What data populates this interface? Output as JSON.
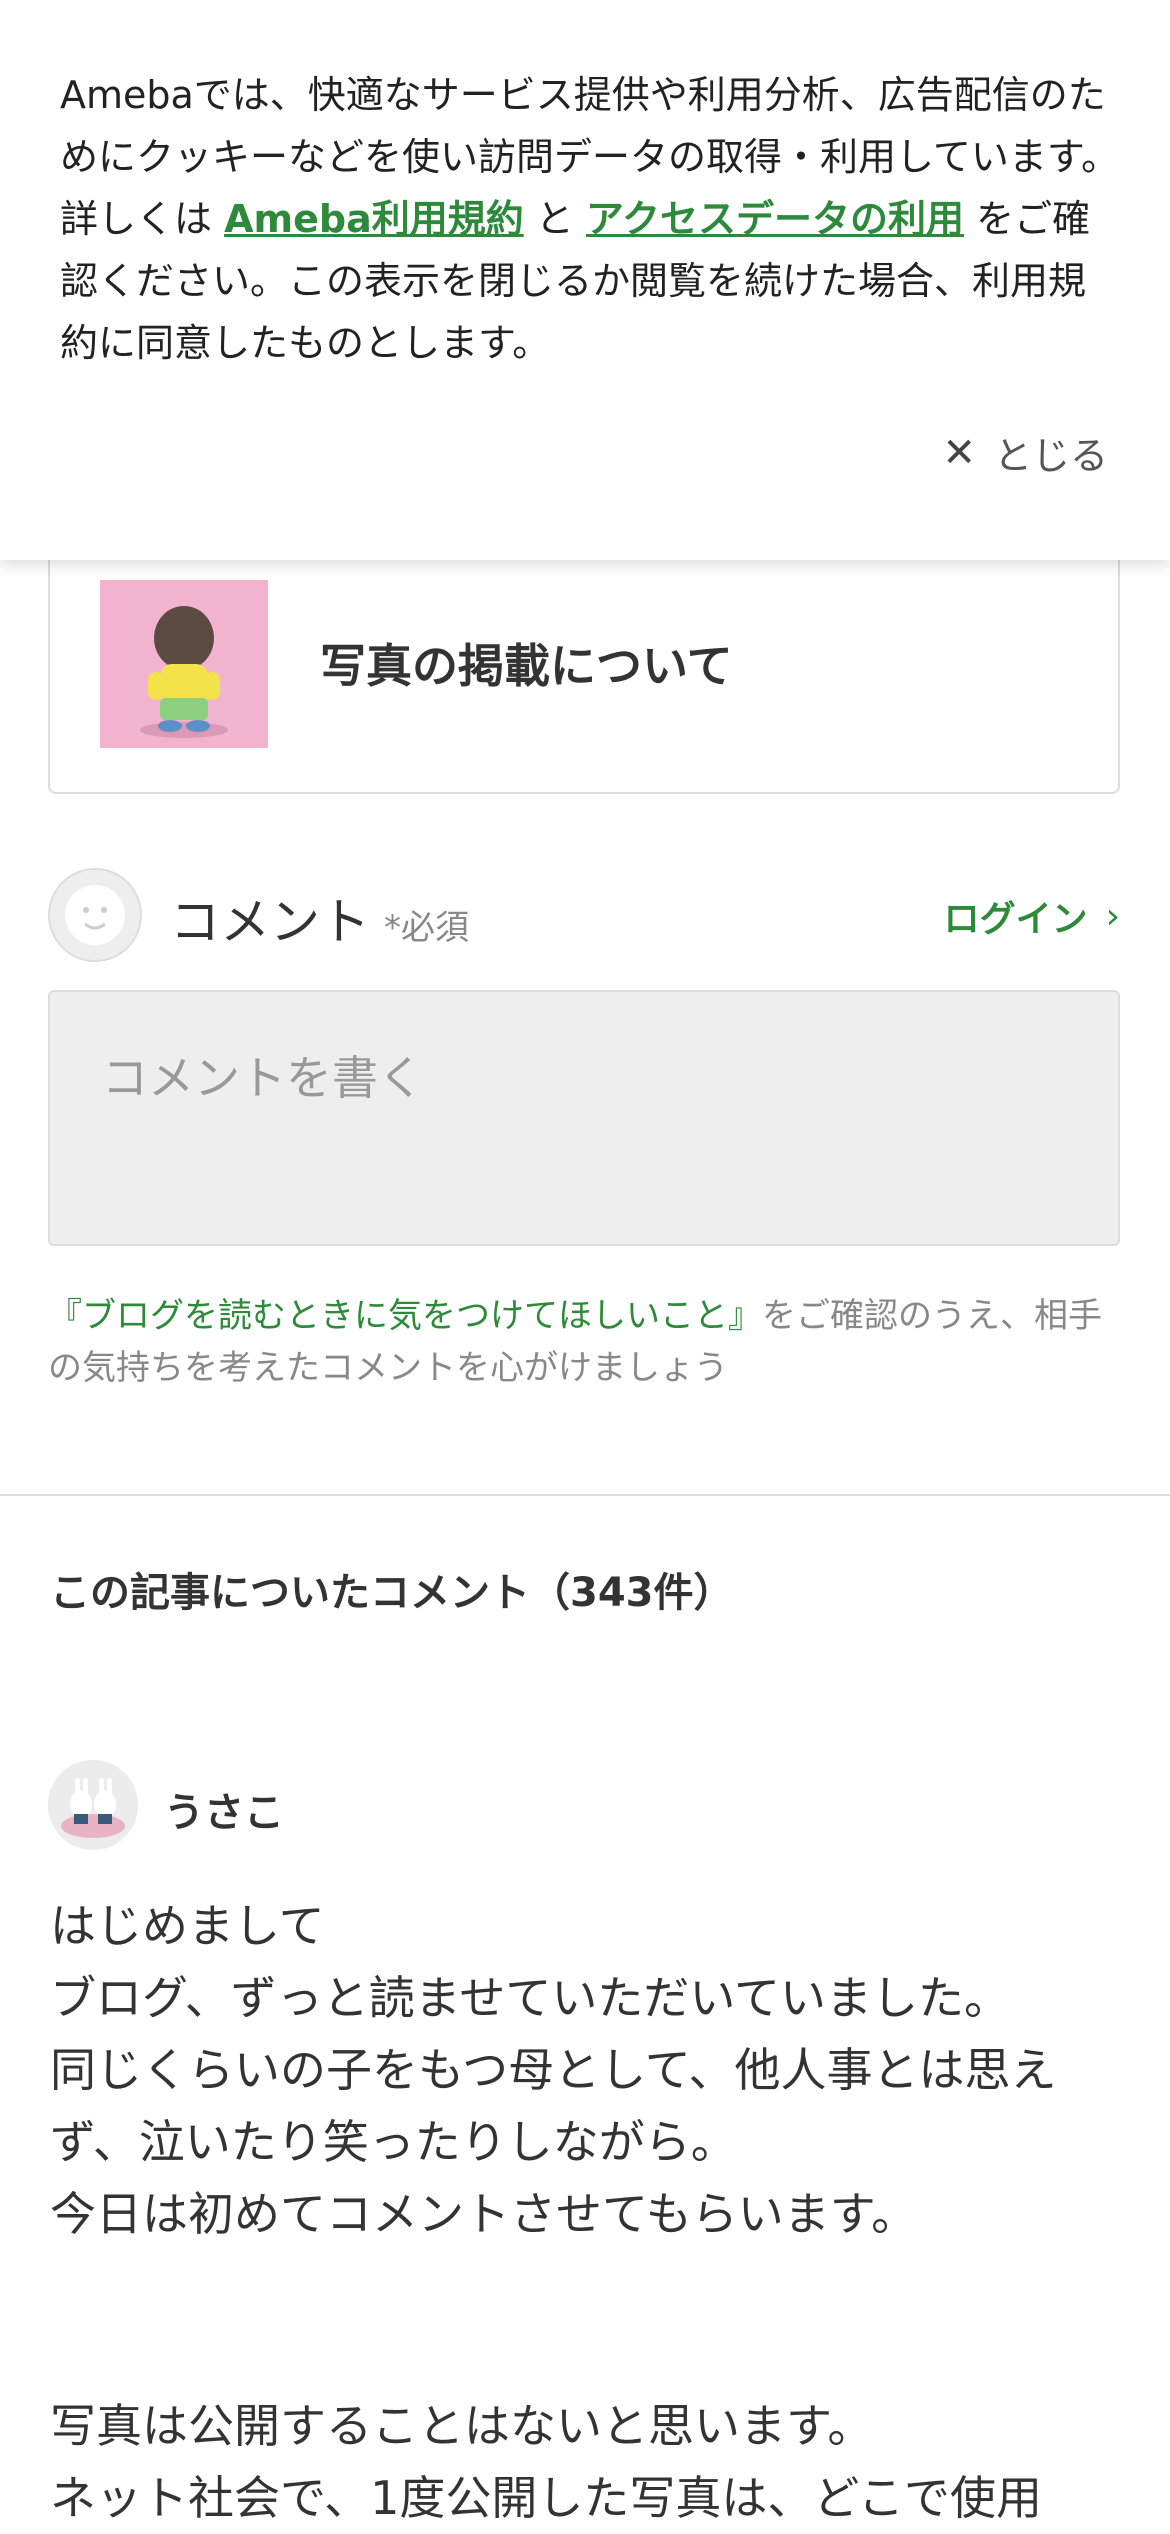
{
  "cookie_banner": {
    "text_before": "Amebaでは、快適なサービス提供や利用分析、広告配信のためにクッキーなどを使い訪問データの取得・利用しています。詳しくは ",
    "link1": "Ameba利用規約",
    "text_mid": " と ",
    "link2": "アクセスデータの利用",
    "text_after": " をご確認ください。この表示を閉じるか閲覧を続けた場合、利用規約に同意したものとします。",
    "close_label": "とじる",
    "close_icon": "close-icon"
  },
  "related_card": {
    "title": "写真の掲載について"
  },
  "comment_form": {
    "label": "コメント",
    "required": "*必須",
    "login_label": "ログイン",
    "placeholder": "コメントを書く",
    "notice_link": "『ブログを読むときに気をつけてほしいこと』",
    "notice_text": "をご確認のうえ、相手の気持ちを考えたコメントを心がけましょう"
  },
  "comments_section": {
    "title": "この記事についたコメント（343件）"
  },
  "comments": [
    {
      "author": "うさこ",
      "paragraphs": [
        "はじめまして",
        "ブログ、ずっと読ませていただいていました。",
        "同じくらいの子をもつ母として、他人事とは思えず、泣いたり笑ったりしながら。",
        "今日は初めてコメントさせてもらいます。",
        "写真は公開することはないと思います。",
        "ネット社会で、1度公開した写真は、どこで使用"
      ]
    }
  ],
  "colors": {
    "accent_green": "#2d8a3a",
    "card_thumb_bg": "#f2b3cf"
  }
}
